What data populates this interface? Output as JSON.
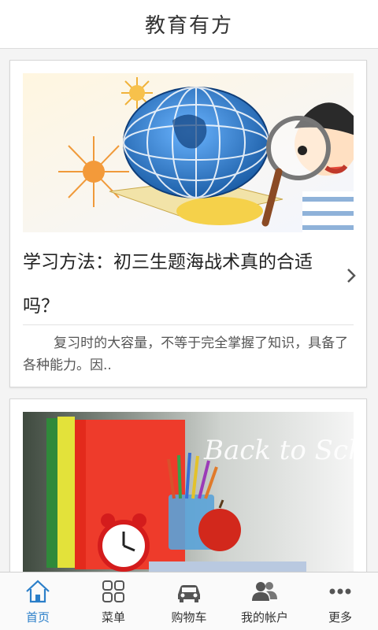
{
  "header": {
    "title": "教育有方"
  },
  "articles": [
    {
      "title": "学习方法：初三生题海战术真的合适吗？",
      "summary": "复习时的大容量，不等于完全掌握了知识，具备了各种能力。因.."
    },
    {
      "image_text": "Back to School"
    }
  ],
  "tabbar": {
    "items": [
      {
        "label": "首页",
        "icon": "home-icon",
        "active": true
      },
      {
        "label": "菜单",
        "icon": "grid-icon"
      },
      {
        "label": "购物车",
        "icon": "car-icon"
      },
      {
        "label": "我的帐户",
        "icon": "users-icon"
      },
      {
        "label": "更多",
        "icon": "more-icon"
      }
    ]
  },
  "colors": {
    "accent": "#2b7fc9",
    "header_bg": "#ffffff",
    "page_bg": "#f4f4f4"
  }
}
